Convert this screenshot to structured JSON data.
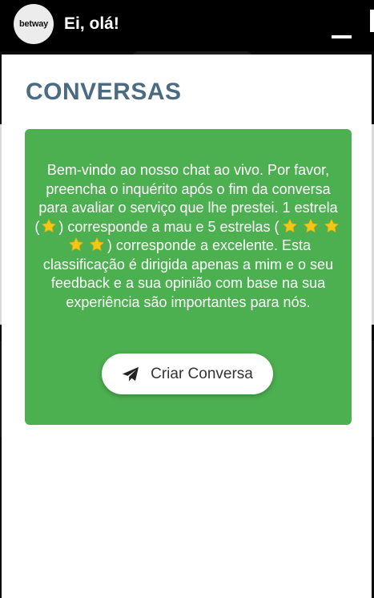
{
  "header": {
    "logo_text": "betway",
    "greeting": "Ei, olá!"
  },
  "panel": {
    "title": "CONVERSAS",
    "message": {
      "part1": "Bem-vindo ao nosso chat ao vivo. Por favor, preencha o inquérito após o fim da conversa para avaliar o serviço que lhe prestei. 1 estrela (",
      "part2": ") corresponde a mau e 5 estrelas (",
      "part3": ") corresponde a excelente. Esta classificação é dirigida apenas a mim e o seu feedback e a sua opinião com base na sua experiência são importantes para nós."
    },
    "cta_label": "Criar Conversa"
  },
  "icons": {
    "star": "star-icon",
    "send": "paper-plane-icon",
    "minimize": "minimize-icon"
  },
  "colors": {
    "card": "#4caf50",
    "title": "#4a6b82",
    "star": "#f5c518"
  }
}
